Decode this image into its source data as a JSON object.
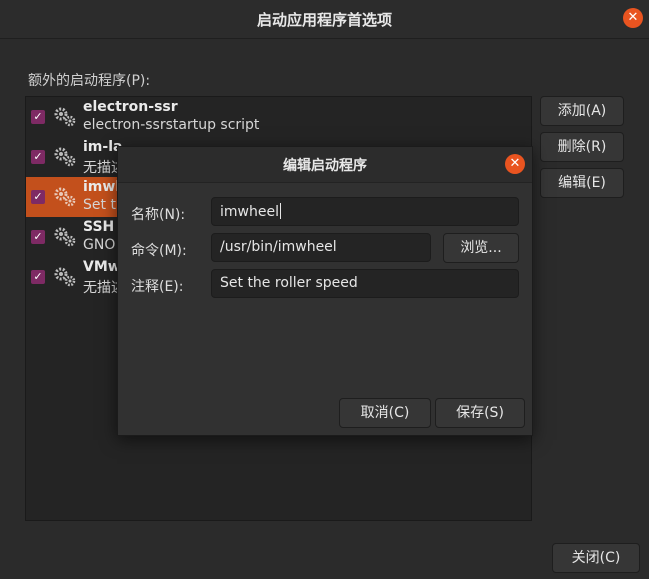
{
  "window": {
    "title": "启动应用程序首选项",
    "close_icon": "✕",
    "list_label": "额外的启动程序(P):",
    "buttons": {
      "add": "添加(A)",
      "delete": "删除(R)",
      "edit": "编辑(E)",
      "close": "关闭(C)"
    }
  },
  "programs": [
    {
      "name": "electron-ssr",
      "desc": "electron-ssrstartup script",
      "checked": true,
      "selected": false
    },
    {
      "name": "im-la",
      "desc": "无描述",
      "checked": true,
      "selected": false
    },
    {
      "name": "imwh",
      "desc": "Set th",
      "checked": true,
      "selected": true
    },
    {
      "name": "SSH",
      "desc": "GNO",
      "checked": true,
      "selected": false
    },
    {
      "name": "VMw",
      "desc": "无描述",
      "checked": true,
      "selected": false
    }
  ],
  "dialog": {
    "title": "编辑启动程序",
    "close_icon": "✕",
    "name_label": "名称(N):",
    "name_value": "imwheel",
    "command_label": "命令(M):",
    "command_value": "/usr/bin/imwheel",
    "browse_label": "浏览...",
    "comment_label": "注释(E):",
    "comment_value": "Set the roller speed",
    "cancel_label": "取消(C)",
    "save_label": "保存(S)"
  },
  "colors": {
    "accent": "#e95420",
    "selection": "#c3501c",
    "checkbox": "#7e2a64"
  }
}
